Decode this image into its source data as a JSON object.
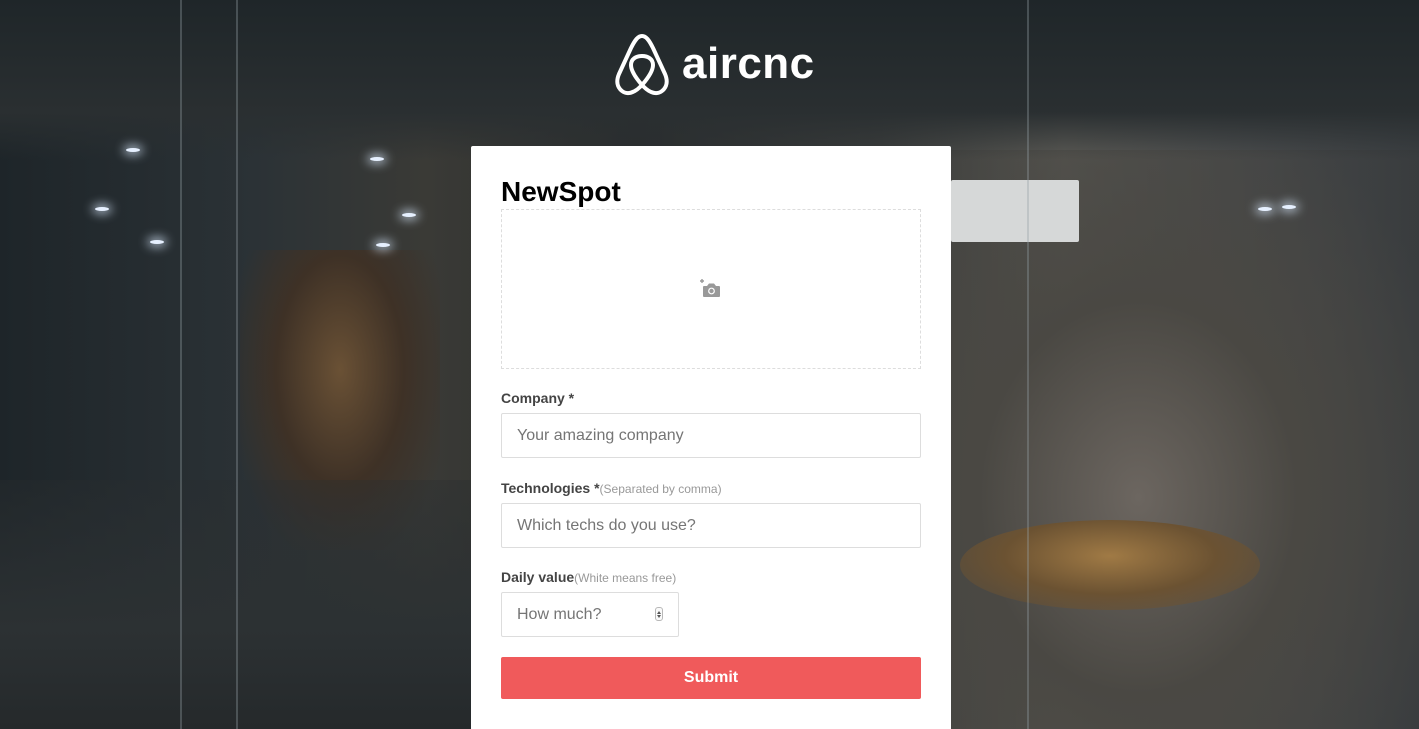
{
  "brand": {
    "name": "aircnc",
    "logo_icon": "airbnb-belo-icon"
  },
  "form": {
    "title": "NewSpot",
    "thumbnail_icon": "add-photo-camera-icon",
    "company": {
      "label": "Company *",
      "placeholder": "Your amazing company",
      "value": ""
    },
    "techs": {
      "label": "Technologies *",
      "hint": "(Separated by comma)",
      "placeholder": "Which techs do you use?",
      "value": ""
    },
    "price": {
      "label": "Daily value",
      "hint": "(White means free)",
      "placeholder": "How much?",
      "value": ""
    },
    "submit_label": "Submit"
  },
  "colors": {
    "accent": "#f05a5b",
    "card_bg": "#ffffff",
    "label": "#444444",
    "hint": "#999999",
    "border": "#dddddd"
  }
}
